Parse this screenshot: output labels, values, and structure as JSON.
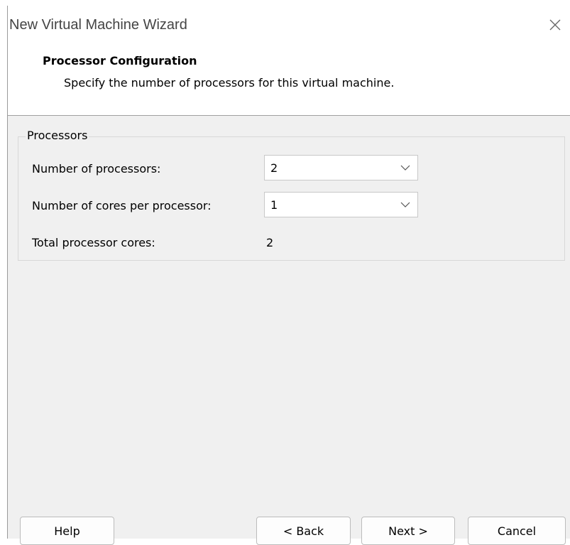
{
  "window": {
    "title": "New Virtual Machine Wizard"
  },
  "header": {
    "title": "Processor Configuration",
    "subtitle": "Specify the number of processors for this virtual machine."
  },
  "processors": {
    "group_label": "Processors",
    "num_processors_label": "Number of processors:",
    "num_processors_value": "2",
    "cores_per_processor_label": "Number of cores per processor:",
    "cores_per_processor_value": "1",
    "total_cores_label": "Total processor cores:",
    "total_cores_value": "2"
  },
  "buttons": {
    "help": "Help",
    "back": "< Back",
    "next": "Next >",
    "cancel": "Cancel"
  }
}
